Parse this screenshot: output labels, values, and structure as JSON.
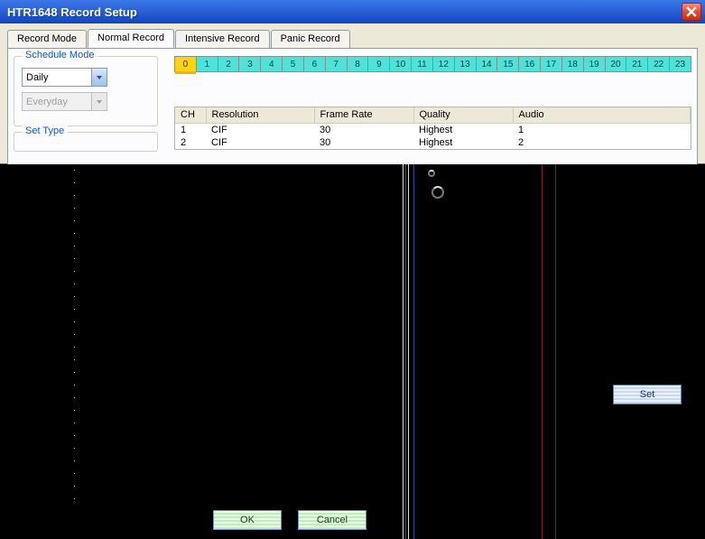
{
  "window": {
    "title": "HTR1648 Record Setup"
  },
  "tabs": {
    "record_mode": "Record Mode",
    "normal_record": "Normal Record",
    "intensive_record": "Intensive Record",
    "panic_record": "Panic Record",
    "active": "normal_record"
  },
  "schedule_mode": {
    "legend": "Schedule Mode",
    "primary": "Daily",
    "secondary": "Everyday"
  },
  "set_type": {
    "legend": "Set Type"
  },
  "hours": [
    "0",
    "1",
    "2",
    "3",
    "4",
    "5",
    "6",
    "7",
    "8",
    "9",
    "10",
    "11",
    "12",
    "13",
    "14",
    "15",
    "16",
    "17",
    "18",
    "19",
    "20",
    "21",
    "22",
    "23"
  ],
  "selected_hour": "0",
  "table": {
    "headers": {
      "ch": "CH",
      "resolution": "Resolution",
      "frame_rate": "Frame Rate",
      "quality": "Quality",
      "audio": "Audio"
    },
    "rows": [
      {
        "ch": "1",
        "resolution": "CIF",
        "frame_rate": "30",
        "quality": "Highest",
        "audio": "1"
      },
      {
        "ch": "2",
        "resolution": "CIF",
        "frame_rate": "30",
        "quality": "Highest",
        "audio": "2"
      }
    ]
  },
  "buttons": {
    "ok": "OK",
    "cancel": "Cancel",
    "set": "Set"
  }
}
